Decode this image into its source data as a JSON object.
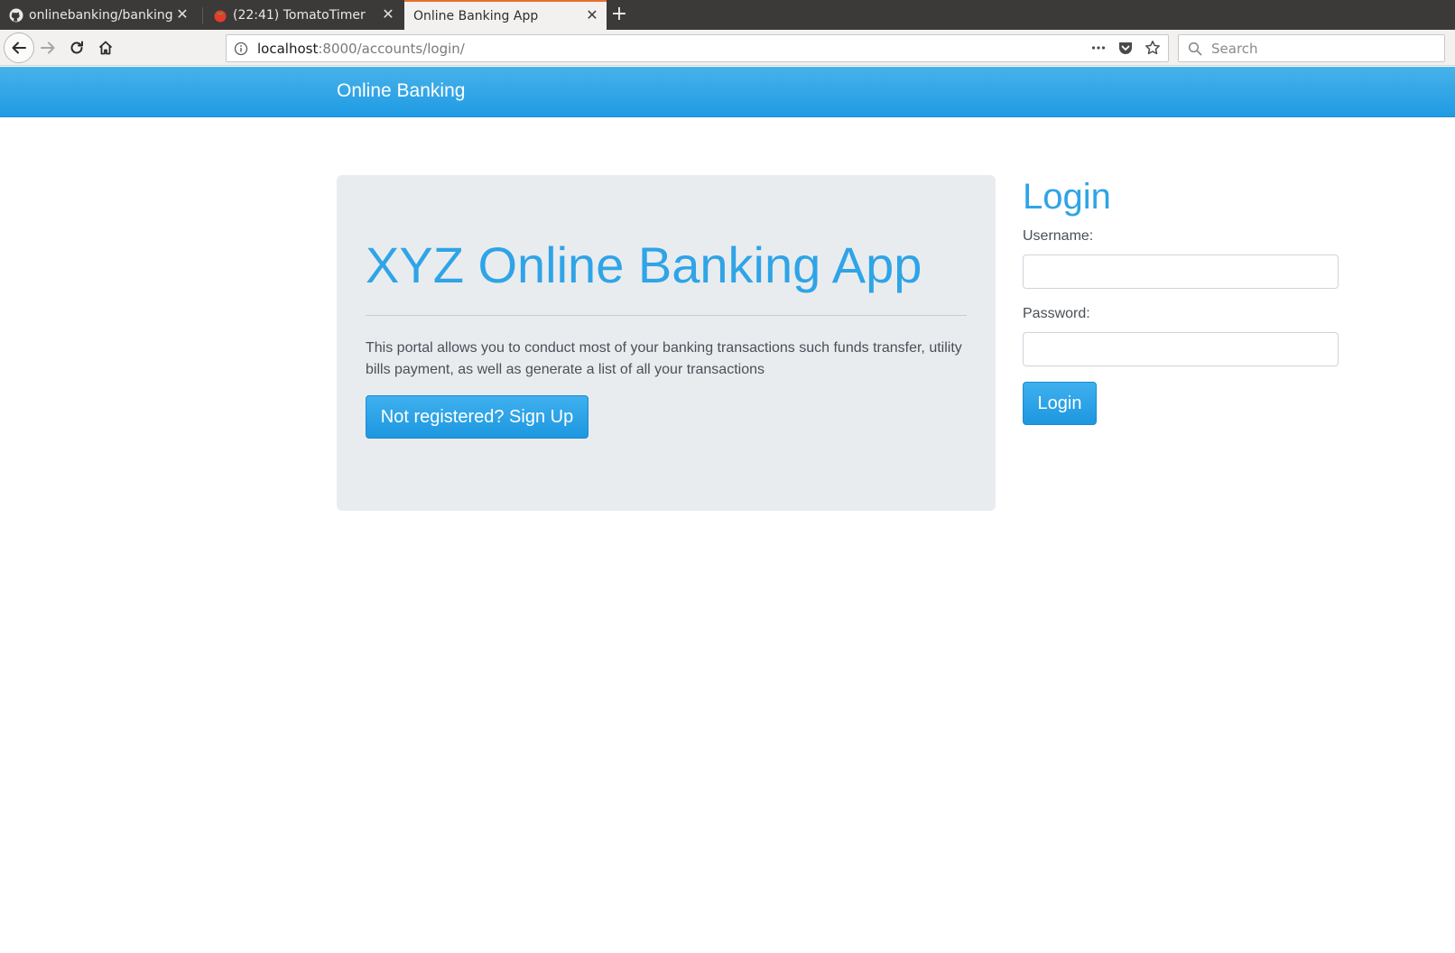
{
  "browser": {
    "tabs": [
      {
        "title": "onlinebanking/banking",
        "icon": "github-icon",
        "active": false
      },
      {
        "title": "(22:41) TomatoTimer",
        "icon": "tomato-icon",
        "active": false
      },
      {
        "title": "Online Banking App",
        "icon": "",
        "active": true
      }
    ],
    "new_tab_label": "+",
    "url": {
      "host": "localhost",
      "path": ":8000/accounts/login/"
    },
    "search_placeholder": "Search",
    "tab_accent_color": "#e96f2e"
  },
  "header": {
    "brand": "Online Banking",
    "background_color": "#2fa4e7"
  },
  "jumbotron": {
    "title": "XYZ Online Banking App",
    "description": "This portal allows you to conduct most of your banking transactions such funds transfer, utility bills payment, as well as generate a list of all your transactions",
    "signup_button": "Not registered? Sign Up"
  },
  "login": {
    "title": "Login",
    "username_label": "Username:",
    "username_value": "",
    "password_label": "Password:",
    "password_value": "",
    "submit_button": "Login"
  }
}
